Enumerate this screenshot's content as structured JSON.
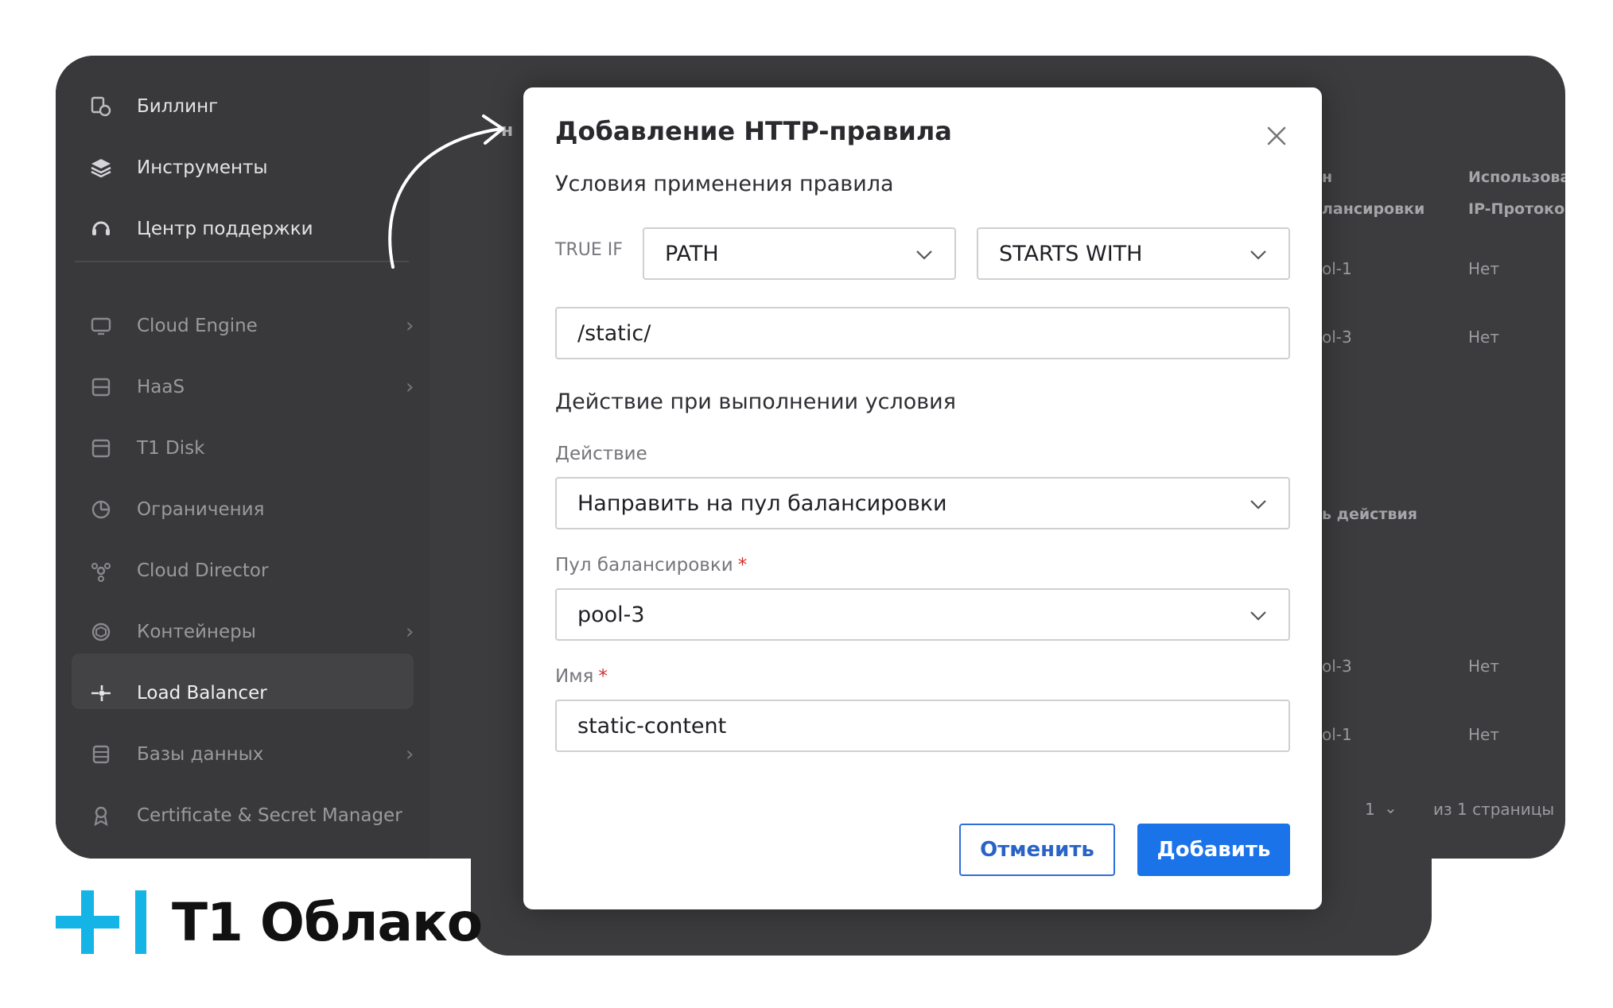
{
  "sidebar": {
    "items": [
      {
        "label": "Биллинг",
        "icon": "billing-icon"
      },
      {
        "label": "Инструменты",
        "icon": "layers-icon"
      },
      {
        "label": "Центр поддержки",
        "icon": "support-icon"
      },
      {
        "label": "Cloud Engine",
        "icon": "cloud-engine-icon"
      },
      {
        "label": "HaaS",
        "icon": "server-icon"
      },
      {
        "label": "T1 Disk",
        "icon": "disk-icon"
      },
      {
        "label": "Ограничения",
        "icon": "limits-icon"
      },
      {
        "label": "Cloud Director",
        "icon": "cloud-director-icon"
      },
      {
        "label": "Контейнеры",
        "icon": "containers-icon"
      },
      {
        "label": "Load Balancer",
        "icon": "load-balancer-icon"
      },
      {
        "label": "Базы данных",
        "icon": "database-icon"
      },
      {
        "label": "Certificate & Secret Manager",
        "icon": "certificate-icon"
      }
    ]
  },
  "background_table": {
    "col1_header": "Пул балансировки",
    "col2_header": "Использовать IP-Протокол",
    "col1_header_line1": "н",
    "col1_header_line2": "лансировки",
    "col2_header_line1": "Использоват",
    "col2_header_line2": "IP-Протокол",
    "rows": [
      {
        "pool": "ol-1",
        "ip": "Нет"
      },
      {
        "pool": "ol-3",
        "ip": "Нет"
      }
    ],
    "rows2": [
      {
        "pool": "ol-3",
        "ip": "Нет"
      },
      {
        "pool": "ol-1",
        "ip": "Нет"
      }
    ],
    "action_header": "ь действия",
    "pagination_page": "1",
    "pagination_total": "из 1 страницы",
    "left_fragment": "н"
  },
  "modal": {
    "title": "Добавление HTTP-правила",
    "conditions_title": "Условия применения правила",
    "true_if_label": "TRUE IF",
    "condition_type": "PATH",
    "condition_operator": "STARTS WITH",
    "condition_value": "/static/",
    "action_section_title": "Действие при выполнении условия",
    "action_label": "Действие",
    "action_value": "Направить на пул балансировки",
    "pool_label": "Пул балансировки",
    "pool_value": "pool-3",
    "name_label": "Имя",
    "name_value": "static-content",
    "required_mark": "*",
    "cancel_label": "Отменить",
    "add_label": "Добавить"
  },
  "brand": {
    "logo_text": "T1 Облако",
    "accent": "#14b4e6",
    "primary_button": "#1a73e8"
  }
}
